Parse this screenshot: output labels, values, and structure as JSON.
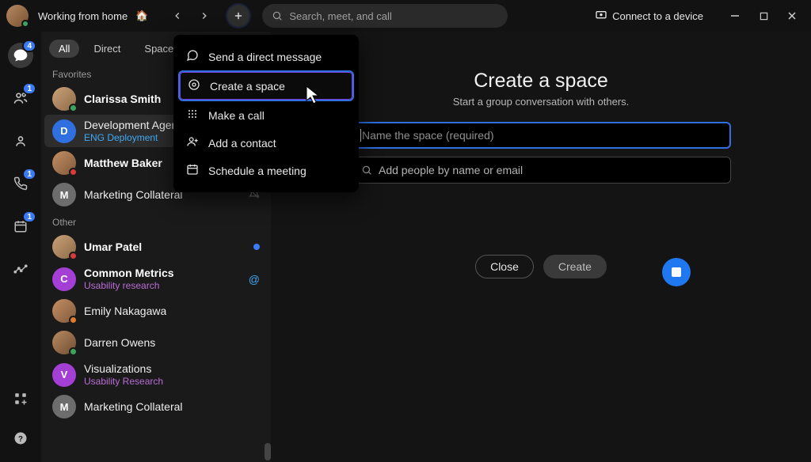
{
  "titlebar": {
    "status_text": "Working from home",
    "status_emoji": "🏠",
    "search_placeholder": "Search, meet, and call",
    "connect_label": "Connect to a device"
  },
  "rail": {
    "badges": {
      "chat": "4",
      "contacts": "1",
      "calls": "1",
      "calendar": "1"
    }
  },
  "tabs": {
    "all": "All",
    "direct": "Direct",
    "spaces": "Spaces"
  },
  "sections": {
    "favorites": "Favorites",
    "other": "Other"
  },
  "favorites": [
    {
      "name": "Clarissa Smith",
      "bold": true,
      "presence": "p-green",
      "initial": ""
    },
    {
      "name": "Development Agenda",
      "sub": "ENG Deployment",
      "subClass": "blue",
      "presence": "",
      "initial": "D",
      "avColor": "#2f6fe0",
      "selected": true
    },
    {
      "name": "Matthew Baker",
      "bold": true,
      "presence": "p-red",
      "initial": ""
    },
    {
      "name": "Marketing Collateral",
      "initial": "M",
      "avColor": "#6d6d6d",
      "indicator": "bell"
    }
  ],
  "other": [
    {
      "name": "Umar Patel",
      "bold": true,
      "presence": "p-red",
      "indicator": "unread"
    },
    {
      "name": "Common Metrics",
      "bold": true,
      "sub": "Usability research",
      "subClass": "purple",
      "initial": "C",
      "avColor": "#a43fd6",
      "indicator": "mention"
    },
    {
      "name": "Emily Nakagawa",
      "presence": "p-orange"
    },
    {
      "name": "Darren Owens",
      "presence": "p-green"
    },
    {
      "name": "Visualizations",
      "sub": "Usability Research",
      "subClass": "purple",
      "initial": "V",
      "avColor": "#a43fd6"
    },
    {
      "name": "Marketing Collateral",
      "initial": "M",
      "avColor": "#6d6d6d"
    }
  ],
  "dropdown": {
    "items": [
      {
        "label": "Send a direct message",
        "icon": "chat"
      },
      {
        "label": "Create a space",
        "icon": "space",
        "highlight": true
      },
      {
        "label": "Make a call",
        "icon": "dial"
      },
      {
        "label": "Add a contact",
        "icon": "contact"
      },
      {
        "label": "Schedule a meeting",
        "icon": "calendar"
      }
    ]
  },
  "main": {
    "title": "Create a space",
    "subtitle": "Start a group conversation with others.",
    "name_placeholder": "Name the space (required)",
    "people_placeholder": "Add people by name or email",
    "close": "Close",
    "create": "Create"
  }
}
